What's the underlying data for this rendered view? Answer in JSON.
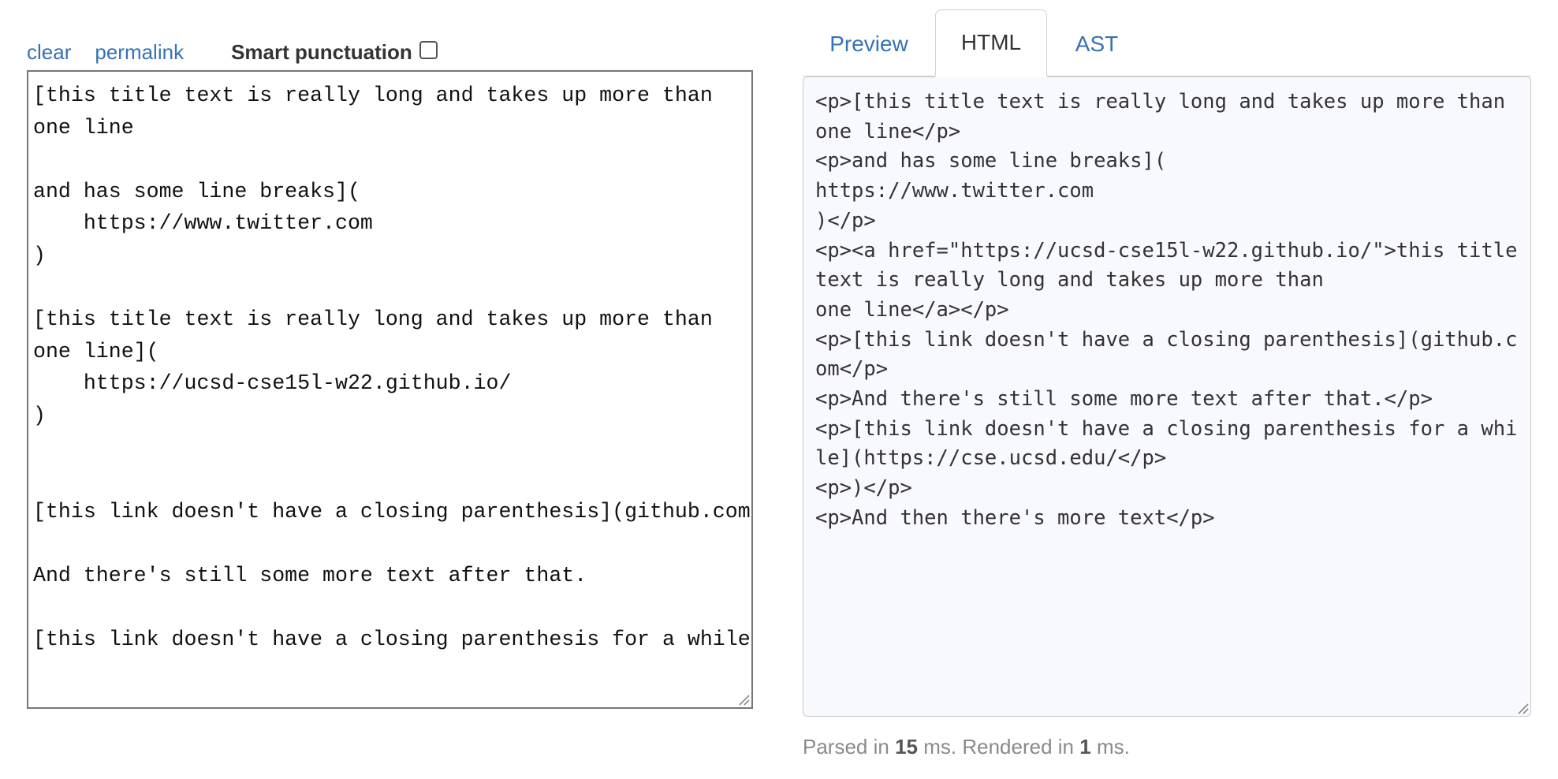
{
  "toolbar": {
    "clear_label": "clear",
    "permalink_label": "permalink",
    "smart_punctuation_label": "Smart punctuation",
    "smart_punctuation_checked": false
  },
  "editor": {
    "text": "[this title text is really long and takes up more than\none line\n\nand has some line breaks](\n    https://www.twitter.com\n)\n\n[this title text is really long and takes up more than\none line](\n    https://ucsd-cse15l-w22.github.io/\n)\n\n\n[this link doesn't have a closing parenthesis](github.com\n\nAnd there's still some more text after that.\n\n[this link doesn't have a closing parenthesis for a while](https://cse.ucsd.edu/"
  },
  "tabs": [
    {
      "label": "Preview",
      "active": false
    },
    {
      "label": "HTML",
      "active": true
    },
    {
      "label": "AST",
      "active": false
    }
  ],
  "output": {
    "html": "<p>[this title text is really long and takes up more than\none line</p>\n<p>and has some line breaks](\nhttps://www.twitter.com\n)</p>\n<p><a href=\"https://ucsd-cse15l-w22.github.io/\">this title text is really long and takes up more than\none line</a></p>\n<p>[this link doesn't have a closing parenthesis](github.com</p>\n<p>And there's still some more text after that.</p>\n<p>[this link doesn't have a closing parenthesis for a while](https://cse.ucsd.edu/</p>\n<p>)</p>\n<p>And then there's more text</p>"
  },
  "status": {
    "parsed_prefix": "Parsed in",
    "parsed_ms": "15",
    "rendered_prefix": "ms. Rendered in",
    "rendered_ms": "1",
    "suffix": "ms."
  },
  "colors": {
    "link": "#3572b6",
    "output_background": "#f8f8ff",
    "status_text": "#8a8a8a"
  }
}
